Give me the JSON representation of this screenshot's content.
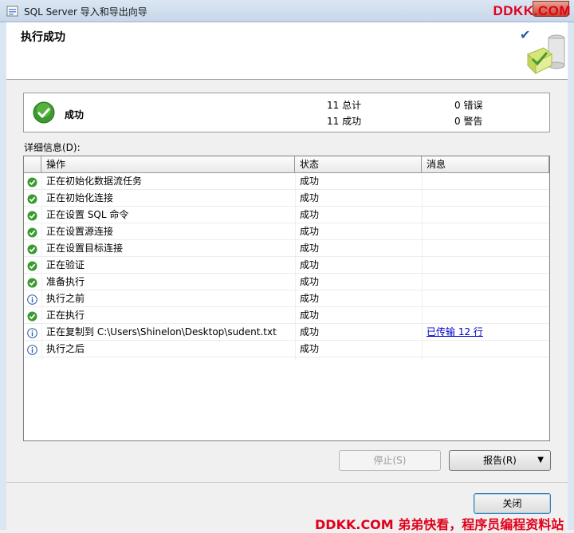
{
  "window": {
    "title": "SQL Server 导入和导出向导",
    "app_icon": "sql-server-icon",
    "watermark_top": "DDKK.COM"
  },
  "header": {
    "title": "执行成功",
    "graphic_icon": "wizard-success-graphic"
  },
  "summary": {
    "status_icon": "success-check-icon",
    "status_text": "成功",
    "total": "11 总计",
    "success": "11 成功",
    "error": "0 错误",
    "warning": "0 警告"
  },
  "details": {
    "label": "详细信息(D):",
    "columns": [
      "操作",
      "状态",
      "消息"
    ],
    "rows": [
      {
        "icon": "success",
        "action": "正在初始化数据流任务",
        "status": "成功",
        "message": ""
      },
      {
        "icon": "success",
        "action": "正在初始化连接",
        "status": "成功",
        "message": ""
      },
      {
        "icon": "success",
        "action": "正在设置 SQL 命令",
        "status": "成功",
        "message": ""
      },
      {
        "icon": "success",
        "action": "正在设置源连接",
        "status": "成功",
        "message": ""
      },
      {
        "icon": "success",
        "action": "正在设置目标连接",
        "status": "成功",
        "message": ""
      },
      {
        "icon": "success",
        "action": "正在验证",
        "status": "成功",
        "message": ""
      },
      {
        "icon": "success",
        "action": "准备执行",
        "status": "成功",
        "message": ""
      },
      {
        "icon": "info",
        "action": "执行之前",
        "status": "成功",
        "message": ""
      },
      {
        "icon": "success",
        "action": "正在执行",
        "status": "成功",
        "message": ""
      },
      {
        "icon": "info",
        "action": "正在复制到 C:\\Users\\Shinelon\\Desktop\\sudent.txt",
        "status": "成功",
        "message": "已传输 12 行"
      },
      {
        "icon": "info",
        "action": "执行之后",
        "status": "成功",
        "message": ""
      }
    ]
  },
  "buttons": {
    "stop": "停止(S)",
    "report": "报告(R)",
    "close": "关闭"
  },
  "watermark_bottom": "DDKK.COM 弟弟快看，程序员编程资料站",
  "colors": {
    "success_green": "#3a9a2e",
    "info_blue": "#2a5aa5",
    "link_blue": "#0000cc",
    "watermark_red": "#e0001b"
  }
}
